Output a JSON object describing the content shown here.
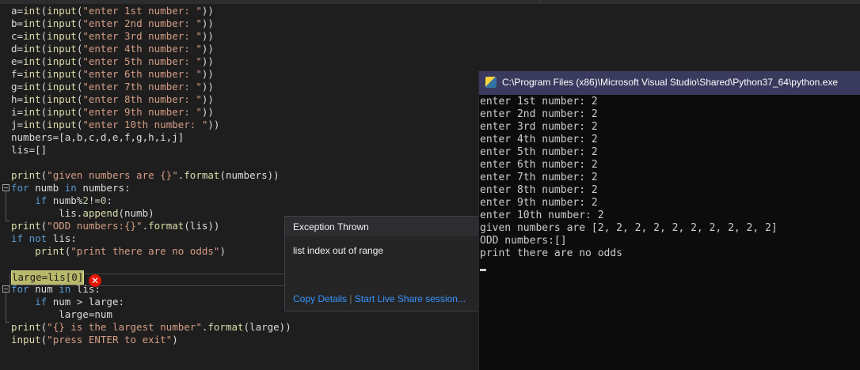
{
  "editor": {
    "lines": [
      "a=int(input(\"enter 1st number: \"))",
      "b=int(input(\"enter 2nd number: \"))",
      "c=int(input(\"enter 3rd number: \"))",
      "d=int(input(\"enter 4th number: \"))",
      "e=int(input(\"enter 5th number: \"))",
      "f=int(input(\"enter 6th number: \"))",
      "g=int(input(\"enter 7th number: \"))",
      "h=int(input(\"enter 8th number: \"))",
      "i=int(input(\"enter 9th number: \"))",
      "j=int(input(\"enter 10th number: \"))",
      "numbers=[a,b,c,d,e,f,g,h,i,j]",
      "lis=[]",
      "",
      "print(\"given numbers are {}\".format(numbers))",
      "for numb in numbers:",
      "    if numb%2!=0:",
      "        lis.append(numb)",
      "print(\"ODD numbers:{}\".format(lis))",
      "if not lis:",
      "    print(\"print there are no odds\")",
      "",
      "large=lis[0]",
      "for num in lis:",
      "    if num > large:",
      "        large=num",
      "print(\"{} is the largest number\".format(large))",
      "input(\"press ENTER to exit\")"
    ],
    "error_glyph": "✕"
  },
  "exception": {
    "title": "Exception Thrown",
    "message": "list index out of range",
    "copy_details": "Copy Details",
    "separator": "|",
    "live_share": "Start Live Share session..."
  },
  "console": {
    "title": "C:\\Program Files (x86)\\Microsoft Visual Studio\\Shared\\Python37_64\\python.exe",
    "lines": [
      "enter 1st number: 2",
      "enter 2nd number: 2",
      "enter 3rd number: 2",
      "enter 4th number: 2",
      "enter 5th number: 2",
      "enter 6th number: 2",
      "enter 7th number: 2",
      "enter 8th number: 2",
      "enter 9th number: 2",
      "enter 10th number: 2",
      "given numbers are [2, 2, 2, 2, 2, 2, 2, 2, 2, 2]",
      "ODD numbers:[]",
      "print there are no odds"
    ]
  },
  "colors": {
    "editor_bg": "#1e1e1e",
    "keyword": "#569cd6",
    "function": "#dcdcaa",
    "string": "#d69d85",
    "number": "#b5cea8",
    "highlight": "#b8b86a",
    "error": "#e51400",
    "link": "#3794ff",
    "console_title_bar": "#3a3a5e"
  }
}
